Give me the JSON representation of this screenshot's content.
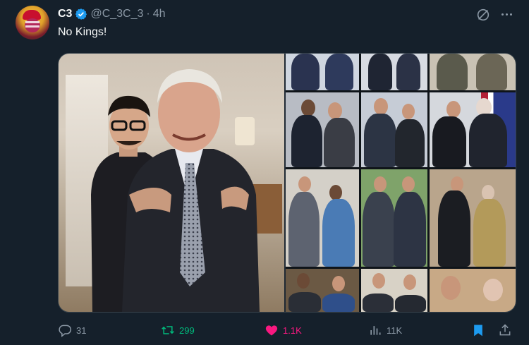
{
  "author": {
    "name": "C3",
    "handle": "@C_3C_3",
    "separator": "·",
    "time": "4h"
  },
  "tweet": {
    "text": "No Kings!"
  },
  "actions": {
    "replies": "31",
    "reposts": "299",
    "likes": "1.1K",
    "views": "11K"
  },
  "colors": {
    "background": "#15202b",
    "verified": "#1d9bf0",
    "repost": "#00ba7c",
    "like": "#f91880",
    "bookmark": "#1d9bf0",
    "muted": "#8b98a5"
  },
  "icons": [
    "verified-badge-icon",
    "grok-icon",
    "more-icon",
    "reply-icon",
    "repost-icon",
    "like-icon",
    "views-icon",
    "bookmark-icon",
    "share-icon"
  ]
}
